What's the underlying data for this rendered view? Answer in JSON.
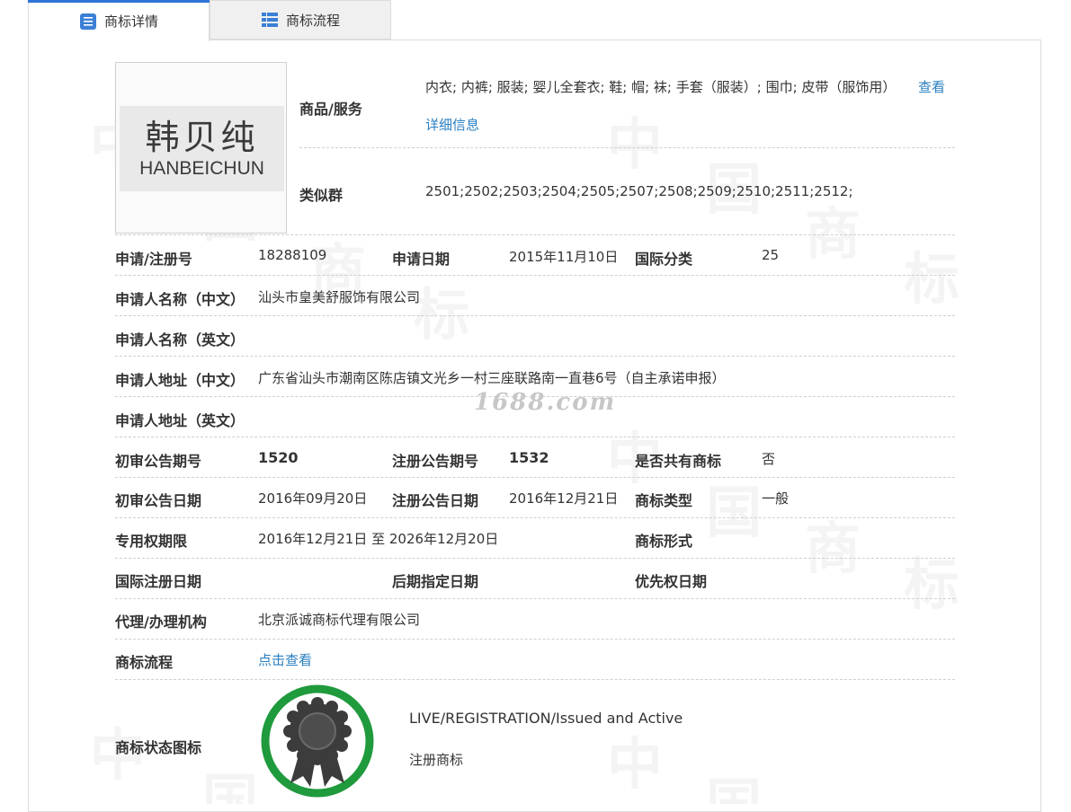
{
  "tabs": [
    {
      "label": "商标详情",
      "icon": "list-icon"
    },
    {
      "label": "商标流程",
      "icon": "grid-icon"
    }
  ],
  "logo": {
    "cn": "韩贝纯",
    "en": "HANBEICHUN"
  },
  "goods": {
    "label": "商品/服务",
    "value": "内衣; 内裤; 服装; 婴儿全套衣; 鞋; 帽; 袜; 手套（服装）; 围巾; 皮带（服饰用）",
    "link_a": "查看",
    "link_b": "详细信息"
  },
  "similar": {
    "label": "类似群",
    "value": "2501;2502;2503;2504;2505;2507;2508;2509;2510;2511;2512;"
  },
  "row_reg": {
    "reg_no_label": "申请/注册号",
    "reg_no": "18288109",
    "app_date_label": "申请日期",
    "app_date": "2015年11月10日",
    "intl_class_label": "国际分类",
    "intl_class": "25"
  },
  "applicant_cn": {
    "label": "申请人名称（中文）",
    "value": "汕头市皇美舒服饰有限公司"
  },
  "applicant_en": {
    "label": "申请人名称（英文）",
    "value": ""
  },
  "address_cn": {
    "label": "申请人地址（中文）",
    "value": "广东省汕头市潮南区陈店镇文光乡一村三座联路南一直巷6号（自主承诺申报）"
  },
  "address_en": {
    "label": "申请人地址（英文）",
    "value": ""
  },
  "row_pub_no": {
    "prelim_no_label": "初审公告期号",
    "prelim_no": "1520",
    "reg_no_label": "注册公告期号",
    "reg_no": "1532",
    "shared_label": "是否共有商标",
    "shared": "否"
  },
  "row_pub_date": {
    "prelim_date_label": "初审公告日期",
    "prelim_date": "2016年09月20日",
    "reg_date_label": "注册公告日期",
    "reg_date": "2016年12月21日",
    "type_label": "商标类型",
    "type": "一般"
  },
  "row_term": {
    "term_label": "专用权期限",
    "term": "2016年12月21日 至 2026年12月20日",
    "form_label": "商标形式",
    "form": ""
  },
  "row_intl": {
    "intl_reg_label": "国际注册日期",
    "intl_reg": "",
    "later_label": "后期指定日期",
    "later": "",
    "priority_label": "优先权日期",
    "priority": ""
  },
  "agent": {
    "label": "代理/办理机构",
    "value": "北京派诚商标代理有限公司"
  },
  "process": {
    "label": "商标流程",
    "link": "点击查看"
  },
  "status": {
    "label": "商标状态图标",
    "en": "LIVE/REGISTRATION/Issued and Active",
    "cn": "注册商标",
    "icon": "registered-seal-icon",
    "ring_color": "#1f9a3c"
  },
  "watermark": {
    "text": "1688.com"
  },
  "colors": {
    "accent": "#2d74d6",
    "link": "#2a7fc1"
  }
}
